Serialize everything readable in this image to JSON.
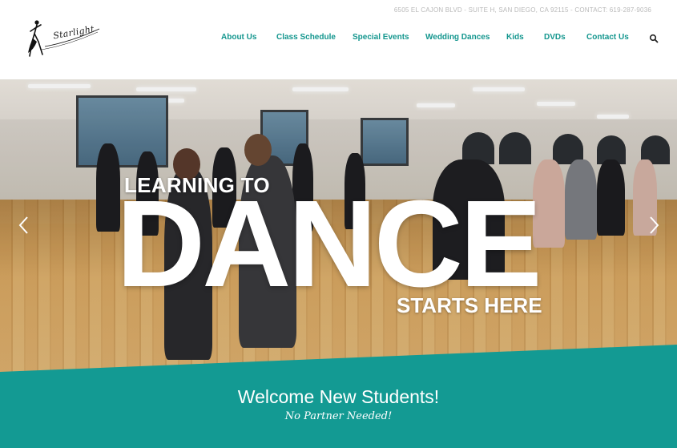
{
  "header": {
    "contact_bar": "6505 EL CAJON BLVD - SUITE H, SAN DIEGO, CA 92115 - CONTACT: 619-287-9036",
    "logo_text": "Starlight",
    "nav": [
      {
        "label": "About Us"
      },
      {
        "label": "Class Schedule"
      },
      {
        "label": "Special Events"
      },
      {
        "label": "Wedding Dances"
      },
      {
        "label": "Kids"
      },
      {
        "label": "DVDs"
      },
      {
        "label": "Contact Us"
      }
    ],
    "search_icon": "search-icon"
  },
  "hero": {
    "line1": "LEARNING TO",
    "line2": "DANCE",
    "line3": "STARTS HERE",
    "prev_icon": "chevron-left-icon",
    "next_icon": "chevron-right-icon"
  },
  "welcome": {
    "title": "Welcome New Students!",
    "subtitle": "No Partner Needed!"
  },
  "colors": {
    "accent": "#139a93",
    "nav_text": "#13968e",
    "contact_text": "#b9b9b9"
  }
}
